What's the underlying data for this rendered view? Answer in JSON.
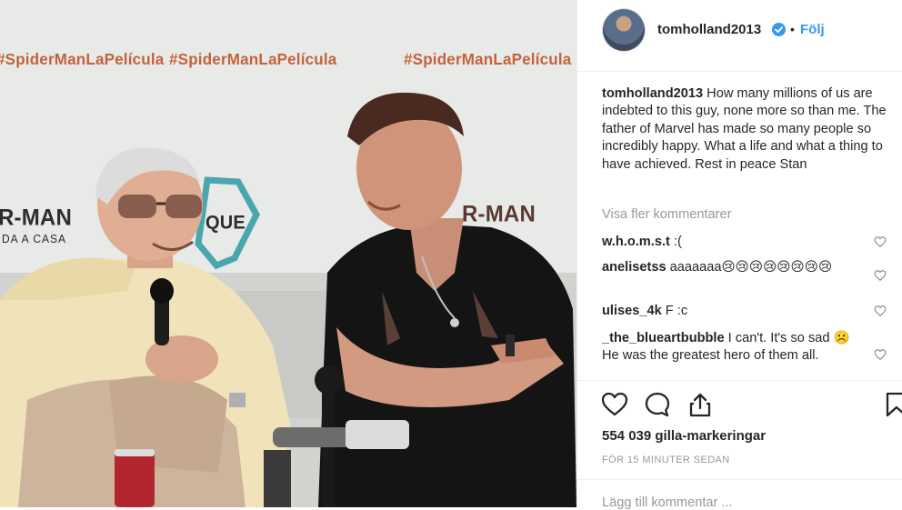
{
  "photo": {
    "hashtags": [
      "#SpiderManLaPelícula",
      "#SpiderManLaPelícula",
      "#SpiderManLaPelícula"
    ],
    "left_logo": "R-MAN",
    "left_logo_sub": "DA A CASA",
    "center_logo": "QUE",
    "right_logo": "R-MAN"
  },
  "header": {
    "username": "tomholland2013",
    "separator": "•",
    "follow_label": "Följ",
    "verified": true
  },
  "caption": {
    "username": "tomholland2013",
    "text": "How many millions of us are indebted to this guy, none more so than me. The father of Marvel has made so many people so incredibly happy. What a life and what a thing to have achieved. Rest in peace Stan"
  },
  "view_more_label": "Visa fler kommentarer",
  "comments": [
    {
      "username": "w.h.o.m.s.t",
      "text": ":("
    },
    {
      "username": "anelisetss",
      "text": "aaaaaaa😢😢😢😢😢😢😢😢"
    },
    {
      "username": "ulises_4k",
      "text": "F :c"
    },
    {
      "username": "_the_blueartbubble",
      "text": "I can't. It's so sad ☹️ He was the greatest hero of them all."
    }
  ],
  "likes_label": "554 039 gilla-markeringar",
  "timestamp": "FÖR 15 MINUTER SEDAN",
  "add_comment_placeholder": "Lägg till kommentar ...",
  "colors": {
    "accent": "#3897f0",
    "muted": "#999999",
    "text": "#262626",
    "banner": "#c4623c"
  }
}
